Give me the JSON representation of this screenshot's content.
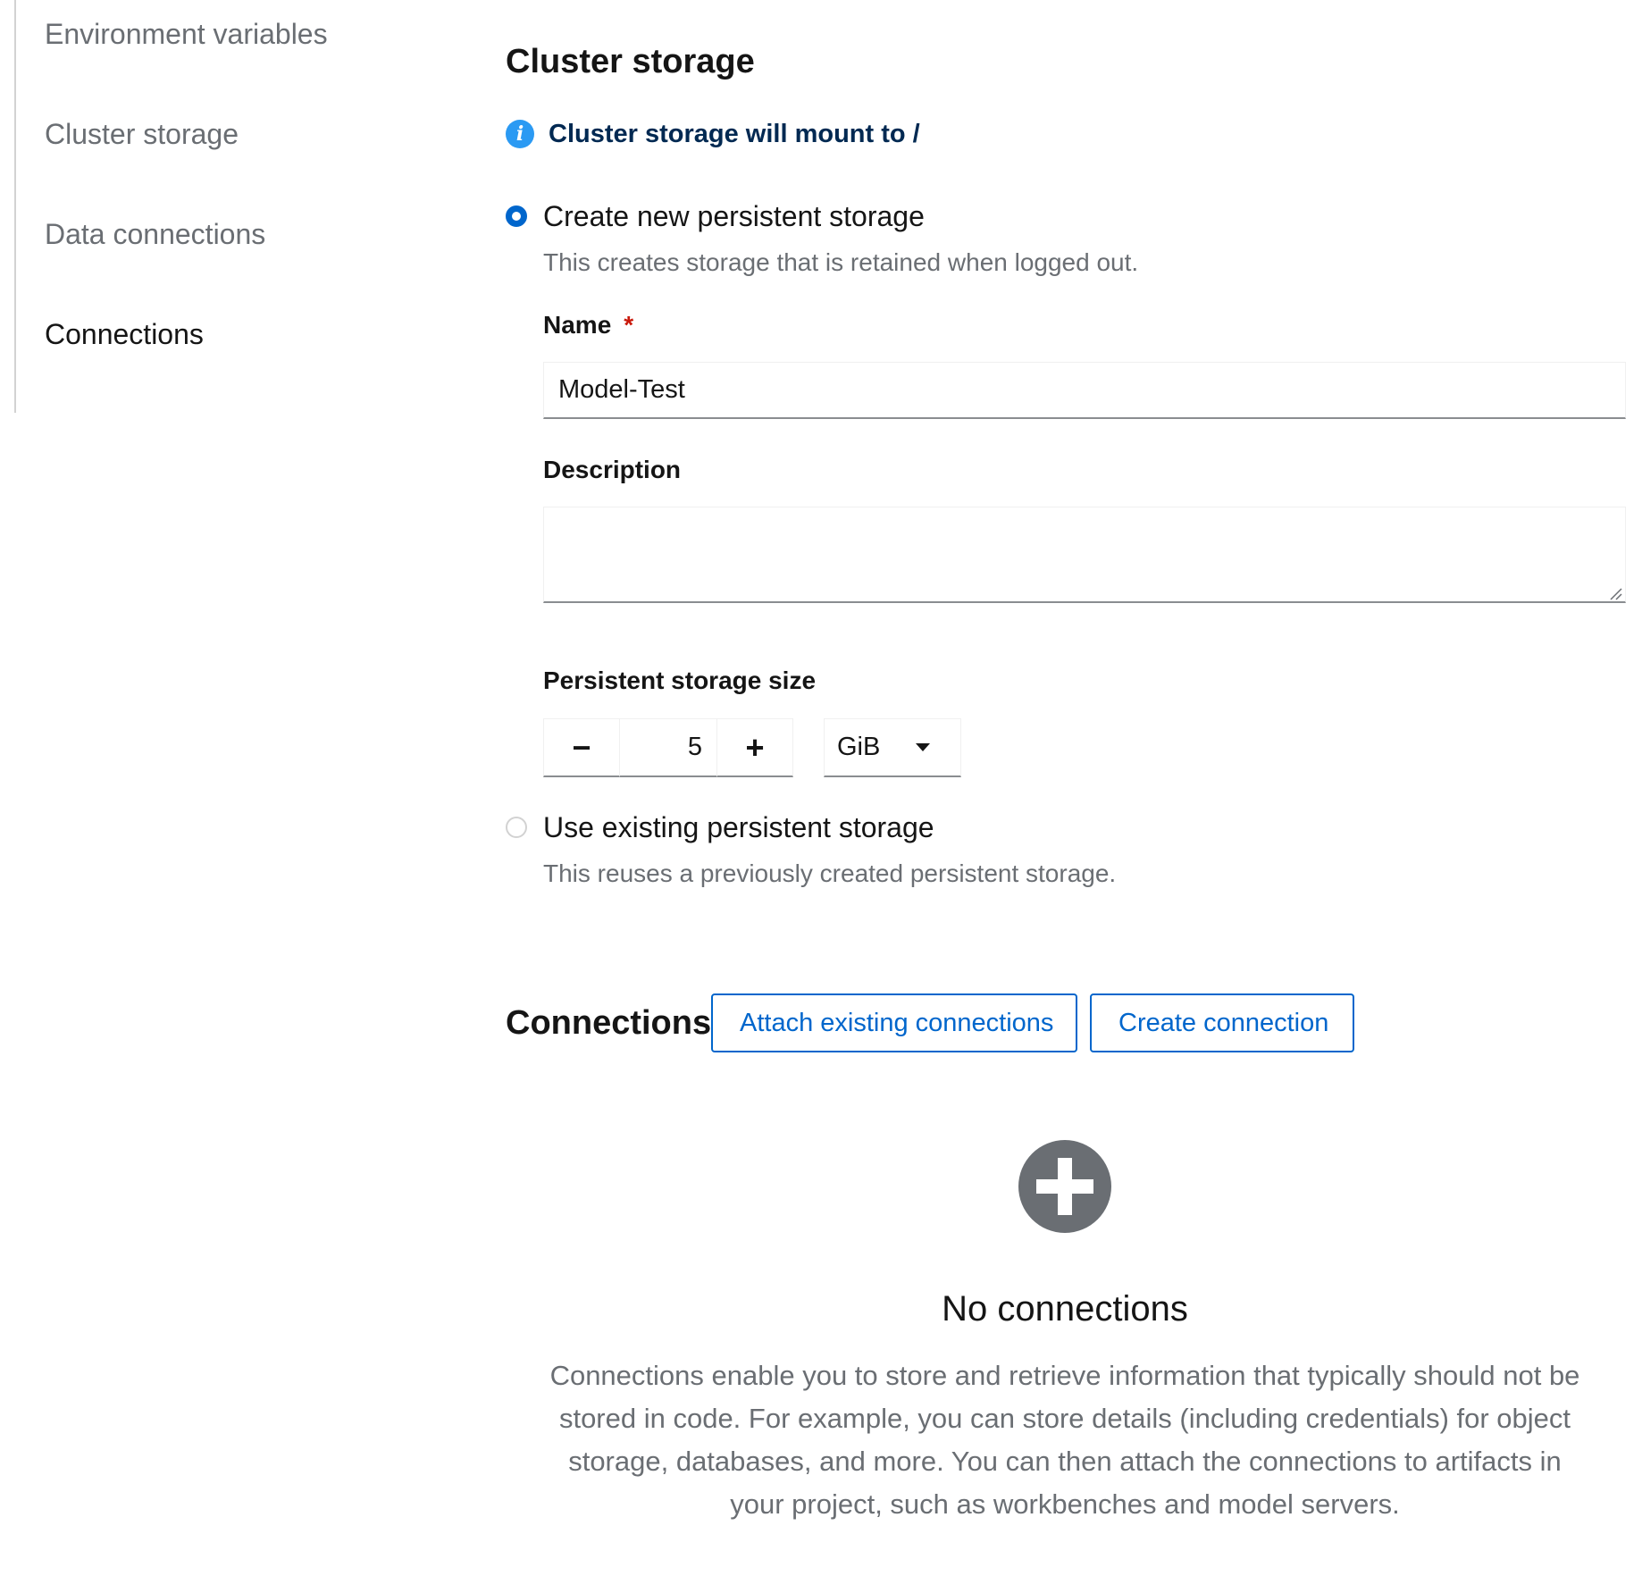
{
  "jump_links": [
    {
      "label": "Environment variables",
      "active": false
    },
    {
      "label": "Cluster storage",
      "active": false
    },
    {
      "label": "Data connections",
      "active": false
    },
    {
      "label": "Connections",
      "active": true
    }
  ],
  "cluster_storage": {
    "title": "Cluster storage",
    "alert": {
      "icon": "info-icon",
      "text": "Cluster storage will mount to /"
    },
    "create_new": {
      "label": "Create new persistent storage",
      "description": "This creates storage that is retained when logged out.",
      "selected": true
    },
    "name_field": {
      "label": "Name",
      "required_marker": "*",
      "value": "Model-Test"
    },
    "description_field": {
      "label": "Description",
      "value": ""
    },
    "size_field": {
      "label": "Persistent storage size",
      "minus": "−",
      "plus": "+",
      "value": "5",
      "unit": "GiB"
    },
    "use_existing": {
      "label": "Use existing persistent storage",
      "description": "This reuses a previously created persistent storage.",
      "selected": false
    }
  },
  "connections": {
    "title": "Connections",
    "attach_button": "Attach existing connections",
    "create_button": "Create connection",
    "empty_state": {
      "icon": "plus-circle-icon",
      "title": "No connections",
      "body": "Connections enable you to store and retrieve information that typically should not be stored in code. For example, you can store details (including credentials) for object storage, databases, and more. You can then attach the connections to artifacts in your project, such as workbenches and model servers."
    }
  },
  "colors": {
    "link_blue": "#0066cc",
    "info_blue": "#2b9af3",
    "alert_text": "#002952",
    "muted_text": "#6a6e73",
    "required_red": "#c9190b"
  }
}
